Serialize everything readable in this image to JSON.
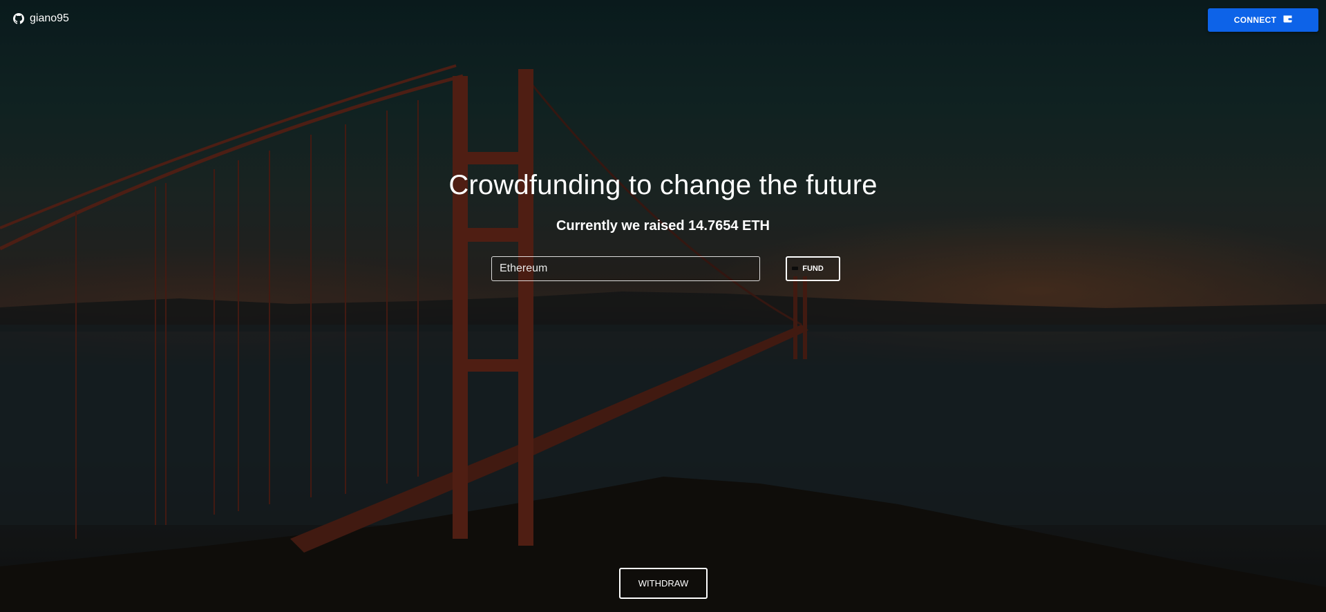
{
  "header": {
    "brand_label": "giano95",
    "brand_icon": "github-icon",
    "connect_label": "CONNECT",
    "connect_icon": "wallet-icon"
  },
  "hero": {
    "title": "Crowdfunding to change the future",
    "subtitle": "Currently we raised 14.7654 ETH"
  },
  "fund_form": {
    "placeholder": "Ethereum",
    "value": "",
    "fund_label": "FUND"
  },
  "withdraw": {
    "label": "WITHDRAW"
  },
  "colors": {
    "accent": "#0d63e8",
    "text": "#ffffff",
    "bridge": "#8a2f1c"
  }
}
